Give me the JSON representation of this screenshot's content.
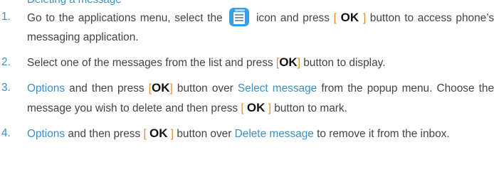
{
  "heading": "Deleting a message",
  "ok_key": "OK",
  "bracket_open": "[",
  "bracket_close": "]",
  "icon_name": "messaging-app-icon",
  "accent_color": "#3a8fc9",
  "bracket_color": "#e8892c",
  "steps": [
    {
      "number": "1.",
      "before_icon": "Go to the applications menu, select the",
      "after_icon": "icon and press",
      "after_ok": "button to access phone’s messaging application."
    },
    {
      "number": "2.",
      "before_ok": "Select one of the messages from the list and press",
      "after_ok": "button to display."
    },
    {
      "number": "3.",
      "options_label": "Options",
      "before_ok": "and then press",
      "mid": "button over",
      "select_message_label": "Select message",
      "after_select": "from the popup menu. Choose the message you wish to delete and then press",
      "after_ok2": "button to mark."
    },
    {
      "number": "4.",
      "options_label": "Options",
      "before_ok": "and then press",
      "mid": "button over",
      "delete_message_label": "Delete message",
      "after_delete": "to remove it from the inbox."
    }
  ]
}
